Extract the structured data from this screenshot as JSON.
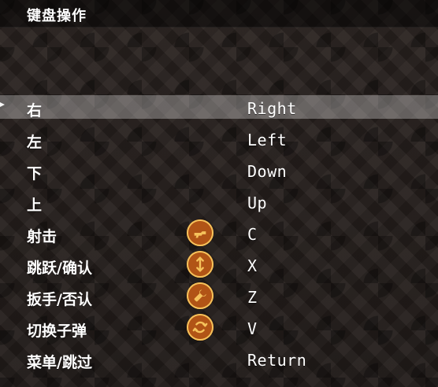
{
  "header": {
    "title": "键盘操作"
  },
  "bindings": [
    {
      "action": "右",
      "key": "Right",
      "icon": null,
      "selected": true
    },
    {
      "action": "左",
      "key": "Left",
      "icon": null,
      "selected": false
    },
    {
      "action": "下",
      "key": "Down",
      "icon": null,
      "selected": false
    },
    {
      "action": "上",
      "key": "Up",
      "icon": null,
      "selected": false
    },
    {
      "action": "射击",
      "key": "C",
      "icon": "gun-icon",
      "selected": false
    },
    {
      "action": "跳跃/确认",
      "key": "X",
      "icon": "jump-icon",
      "selected": false
    },
    {
      "action": "扳手/否认",
      "key": "Z",
      "icon": "wrench-icon",
      "selected": false
    },
    {
      "action": "切换子弹",
      "key": "V",
      "icon": "swap-ammo-icon",
      "selected": false
    },
    {
      "action": "菜单/跳过",
      "key": "Return",
      "icon": null,
      "selected": false
    }
  ],
  "colors": {
    "accent_orange": "#b15416",
    "accent_gold": "#f5c25b"
  }
}
